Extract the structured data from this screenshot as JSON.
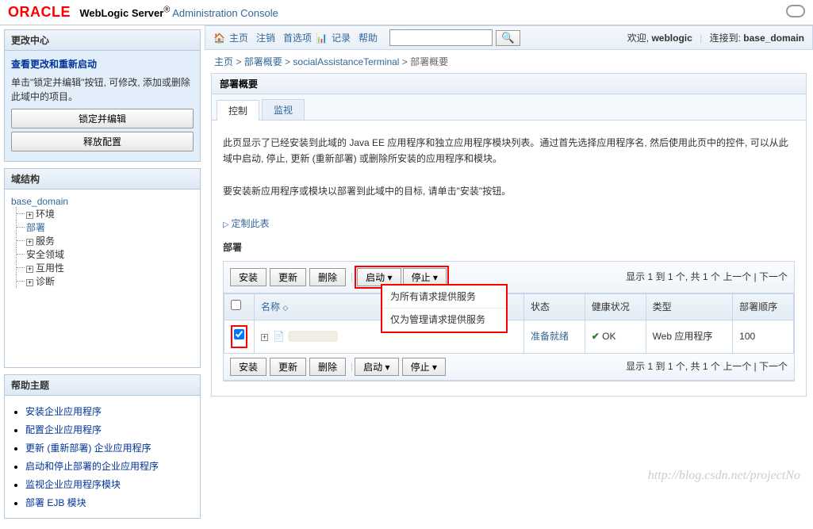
{
  "header": {
    "logo_text": "ORACLE",
    "server_label": "WebLogic Server",
    "reg_mark": "®",
    "subtitle": "Administration Console"
  },
  "toolbar": {
    "home": "主页",
    "logout": "注销",
    "preferences": "首选项",
    "record": "记录",
    "help": "帮助",
    "search_placeholder": "",
    "welcome_prefix": "欢迎, ",
    "user": "weblogic",
    "connected_prefix": "连接到: ",
    "domain": "base_domain"
  },
  "breadcrumb": {
    "items": [
      "主页",
      "部署概要",
      "socialAssistanceTerminal",
      "部署概要"
    ]
  },
  "change_center": {
    "title": "更改中心",
    "view_link": "查看更改和重新启动",
    "desc": "单击\"锁定并编辑\"按钮, 可修改, 添加或删除此域中的项目。",
    "lock_btn": "锁定并编辑",
    "release_btn": "释放配置"
  },
  "domain_structure": {
    "title": "域结构",
    "root": "base_domain",
    "items": [
      "环境",
      "部署",
      "服务",
      "安全领域",
      "互用性",
      "诊断"
    ]
  },
  "help_topics": {
    "title": "帮助主题",
    "items": [
      "安装企业应用程序",
      "配置企业应用程序",
      "更新 (重新部署) 企业应用程序",
      "启动和停止部署的企业应用程序",
      "监视企业应用程序模块",
      "部署 EJB 模块"
    ]
  },
  "content": {
    "section_title": "部署概要",
    "tabs": [
      "控制",
      "监视"
    ],
    "desc1": "此页显示了已经安装到此域的 Java EE 应用程序和独立应用程序模块列表。通过首先选择应用程序名, 然后使用此页中的控件, 可以从此域中启动, 停止, 更新 (重新部署) 或删除所安装的应用程序和模块。",
    "desc2": "要安装新应用程序或模块以部署到此域中的目标, 请单击\"安装\"按钮。",
    "customize": "定制此表",
    "deploy_label": "部署",
    "buttons": {
      "install": "安装",
      "update": "更新",
      "delete": "删除",
      "start": "启动",
      "stop": "停止"
    },
    "dropdown": {
      "all_requests": "为所有请求提供服务",
      "admin_only": "仅为管理请求提供服务"
    },
    "pager": "显示 1 到 1 个, 共 1 个  上一个 | 下一个",
    "table": {
      "headers": {
        "name": "名称",
        "state": "状态",
        "health": "健康状况",
        "type": "类型",
        "order": "部署顺序"
      },
      "rows": [
        {
          "checked": true,
          "state": "准备就绪",
          "health": "OK",
          "type": "Web 应用程序",
          "order": "100"
        }
      ]
    }
  },
  "watermark": "http://blog.csdn.net/projectNo"
}
